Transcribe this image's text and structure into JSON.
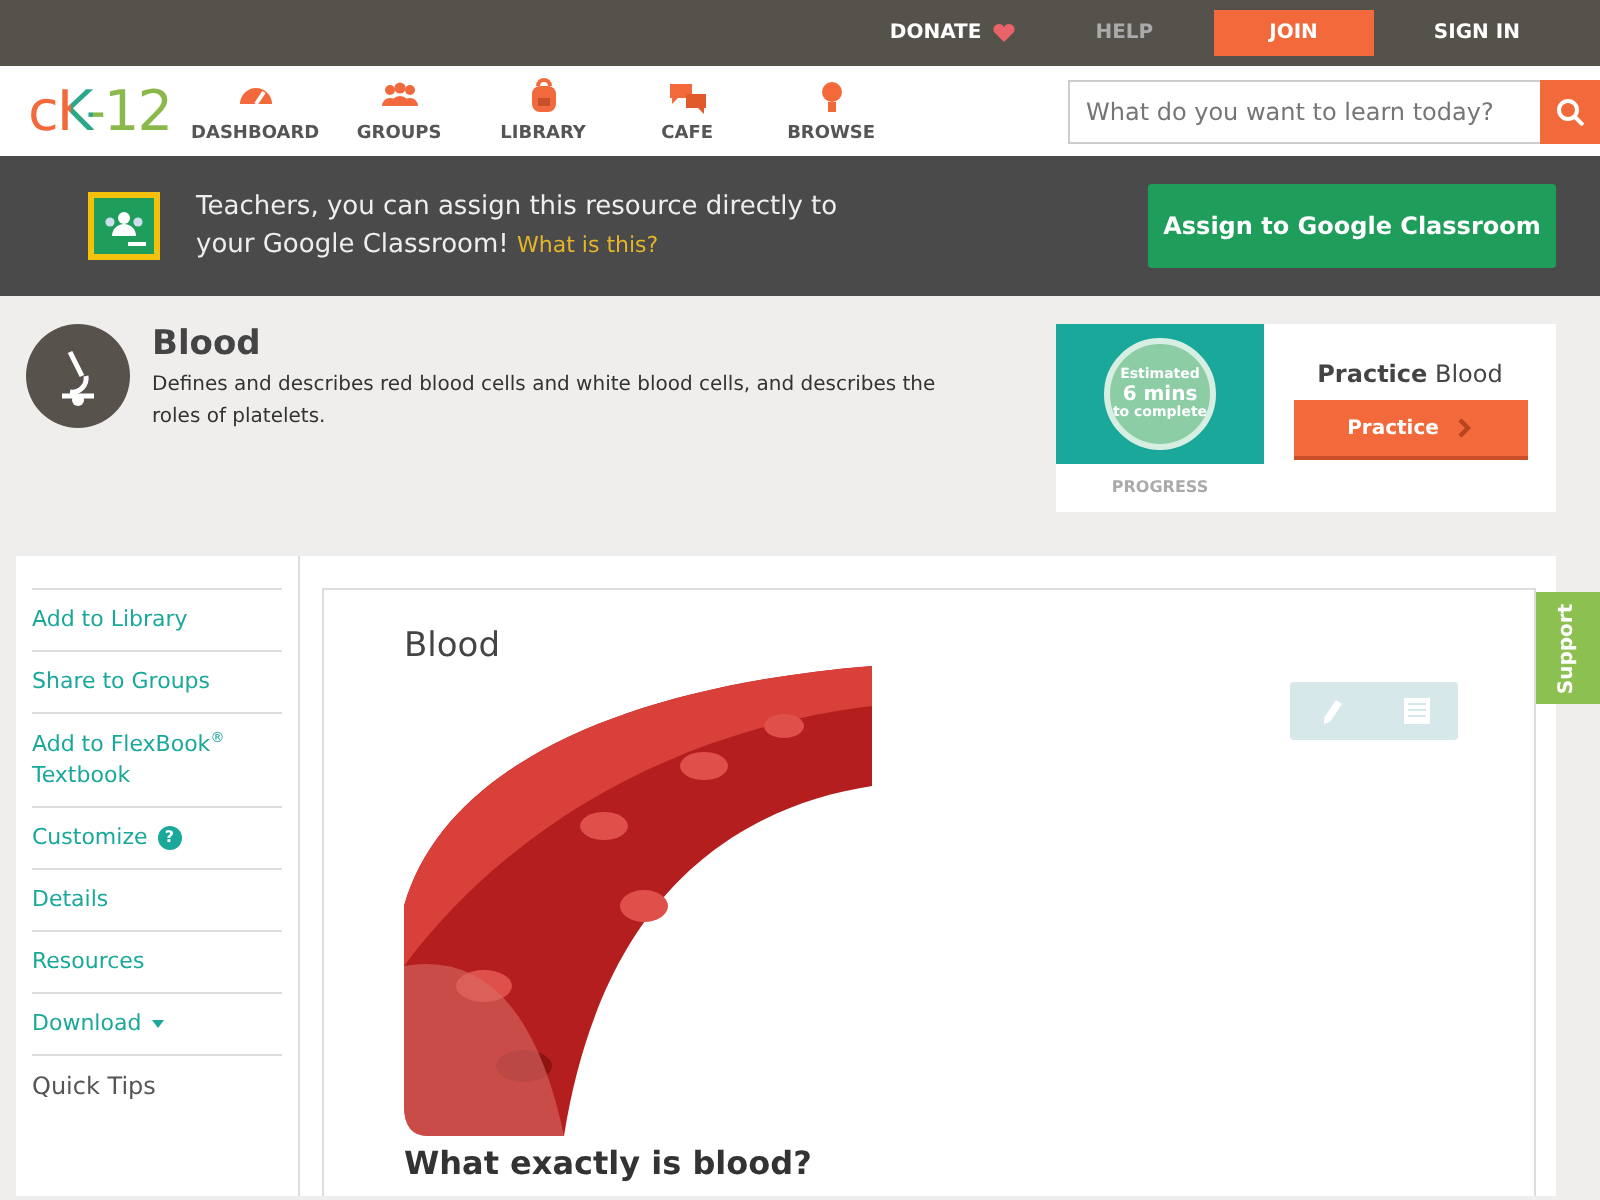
{
  "top_bar": {
    "links": [
      {
        "label": "DONATE",
        "kind": "donate"
      },
      {
        "label": "HELP",
        "kind": "plain"
      },
      {
        "label": "JOIN",
        "kind": "primary"
      },
      {
        "label": "SIGN IN",
        "kind": "plain"
      }
    ]
  },
  "nav": {
    "logo": "cK-12",
    "items": [
      {
        "label": "DASHBOARD"
      },
      {
        "label": "GROUPS"
      },
      {
        "label": "LIBRARY"
      },
      {
        "label": "CAFE"
      },
      {
        "label": "BROWSE"
      }
    ],
    "search": {
      "placeholder": "What do you want to learn today?"
    }
  },
  "banner": {
    "message": "Teachers, you can assign this resource directly to your Google Classroom!",
    "link": "What is this?",
    "button": "Assign to Google Classroom"
  },
  "concept": {
    "title": "Blood",
    "description": "Defines and describes red blood cells and white blood cells, and describes the roles of platelets.",
    "practice": {
      "estimate": [
        "Estimated",
        "6 mins",
        "to complete"
      ],
      "progress_label": "PROGRESS",
      "title": "**Practice** Blood",
      "button": "Practice"
    }
  },
  "sidebar": {
    "items": [
      {
        "label": "Add to Library",
        "kind": "link"
      },
      {
        "label": "Share to Groups",
        "kind": "link"
      },
      {
        "label": "Add to FlexBook$^{®}$ Textbook",
        "kind": "link"
      },
      {
        "label": "Customize",
        "kind": "help",
        "badge": "?"
      },
      {
        "label": "Details",
        "kind": "link"
      },
      {
        "label": "Resources",
        "kind": "link"
      },
      {
        "label": "Download",
        "kind": "menu"
      },
      {
        "label": "Quick Tips",
        "kind": "heading"
      }
    ]
  },
  "content": {
    "title": "Blood",
    "heading": "What exactly is blood?"
  },
  "support_tab": "Support"
}
